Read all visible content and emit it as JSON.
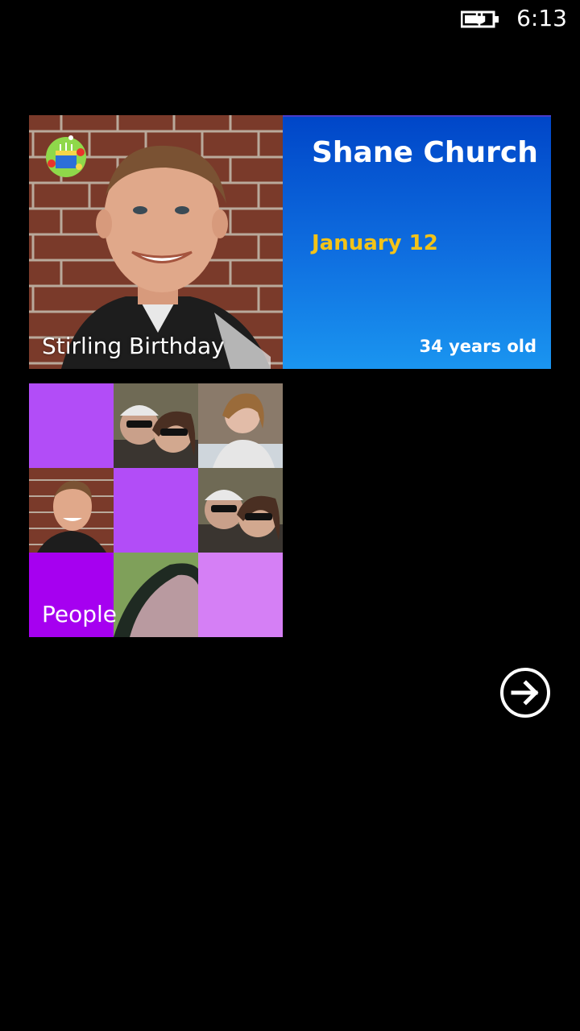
{
  "status_bar": {
    "time": "6:13",
    "battery_icon": "battery-charging-icon"
  },
  "birthday_tile": {
    "label": "Stirling Birthday",
    "contact_name": "Shane Church",
    "date": "January 12",
    "age": "34 years old",
    "badge_icon": "birthday-cake-icon",
    "accent_color": "#0046c8",
    "date_color": "#f3c318"
  },
  "people_tile": {
    "label": "People",
    "accent_color": "#b24df7"
  },
  "navigation": {
    "next_icon": "arrow-right-circle-icon"
  }
}
